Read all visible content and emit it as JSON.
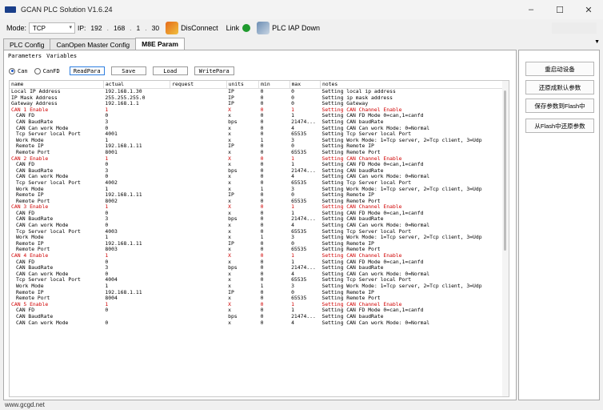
{
  "window": {
    "title": "GCAN PLC Solution V1.6.24",
    "minimize": "–",
    "maximize": "☐",
    "close": "✕"
  },
  "toolbar": {
    "mode_label": "Mode:",
    "mode_value": "TCP",
    "ip_label": "IP:",
    "ip": [
      "192",
      "168",
      "1",
      "30"
    ],
    "disconnect_label": "DisConnect",
    "link_label": "Link",
    "link_status_color": "#1f9a2e",
    "plc_iap_label": "PLC IAP Down"
  },
  "tabs": [
    {
      "label": "PLC Config",
      "active": false
    },
    {
      "label": "CanOpen Master Config",
      "active": false
    },
    {
      "label": "M8E Param",
      "active": true
    }
  ],
  "subtabs": [
    "Parameters",
    "Variables"
  ],
  "controls": {
    "radio_can": "Can",
    "radio_canfd": "CanFD",
    "buttons": [
      "ReadPara",
      "Save",
      "Load",
      "WritePara"
    ]
  },
  "grid": {
    "columns": [
      "name",
      "actual",
      "request",
      "units",
      "min",
      "max",
      "notes"
    ],
    "rows": [
      {
        "name": "Local IP Address",
        "actual": "192.168.1.30",
        "units": "IP",
        "min": "0",
        "max": "0",
        "notes": "Setting local ip address",
        "hl": false,
        "indent": false
      },
      {
        "name": "IP Mask Address",
        "actual": "255.255.255.0",
        "units": "IP",
        "min": "0",
        "max": "0",
        "notes": "Setting ip mask address",
        "hl": false,
        "indent": false
      },
      {
        "name": "Gateway Address",
        "actual": "192.168.1.1",
        "units": "IP",
        "min": "0",
        "max": "0",
        "notes": "Setting Gateway",
        "hl": false,
        "indent": false
      },
      {
        "name": "CAN 1 Enable",
        "actual": "1",
        "units": "X",
        "min": "0",
        "max": "1",
        "notes": "Setting CAN Channel Enable",
        "hl": true,
        "indent": false
      },
      {
        "name": "CAN FD",
        "actual": "0",
        "units": "x",
        "min": "0",
        "max": "1",
        "notes": "Setting CAN FD Mode 0=can,1=canfd",
        "hl": false,
        "indent": true
      },
      {
        "name": "CAN BaudRate",
        "actual": "3",
        "units": "bps",
        "min": "0",
        "max": "21474...",
        "notes": "Setting CAN baudRate",
        "hl": false,
        "indent": true
      },
      {
        "name": "CAN Can work Mode",
        "actual": "0",
        "units": "x",
        "min": "0",
        "max": "4",
        "notes": "Setting CAN Can work Mode: 0=Normal",
        "hl": false,
        "indent": true
      },
      {
        "name": "Tcp Server local Port",
        "actual": "4001",
        "units": "x",
        "min": "0",
        "max": "65535",
        "notes": "Setting Tcp Server local Port",
        "hl": false,
        "indent": true
      },
      {
        "name": "Work Mode",
        "actual": "1",
        "units": "x",
        "min": "1",
        "max": "3",
        "notes": "Setting Work Mode: 1=Tcp server, 2=Tcp client, 3=Udp",
        "hl": false,
        "indent": true
      },
      {
        "name": "Remote IP",
        "actual": "192.168.1.11",
        "units": "IP",
        "min": "0",
        "max": "0",
        "notes": "Setting Remote IP",
        "hl": false,
        "indent": true
      },
      {
        "name": "Remote Port",
        "actual": "8001",
        "units": "x",
        "min": "0",
        "max": "65535",
        "notes": "Setting Remote Port",
        "hl": false,
        "indent": true
      },
      {
        "name": "CAN 2 Enable",
        "actual": "1",
        "units": "X",
        "min": "0",
        "max": "1",
        "notes": "Setting CAN Channel Enable",
        "hl": true,
        "indent": false
      },
      {
        "name": "CAN FD",
        "actual": "0",
        "units": "x",
        "min": "0",
        "max": "1",
        "notes": "Setting CAN FD Mode 0=can,1=canfd",
        "hl": false,
        "indent": true
      },
      {
        "name": "CAN BaudRate",
        "actual": "3",
        "units": "bps",
        "min": "0",
        "max": "21474...",
        "notes": "Setting CAN baudRate",
        "hl": false,
        "indent": true
      },
      {
        "name": "CAN Can work Mode",
        "actual": "0",
        "units": "x",
        "min": "0",
        "max": "4",
        "notes": "Setting CAN Can work Mode: 0=Normal",
        "hl": false,
        "indent": true
      },
      {
        "name": "Tcp Server local Port",
        "actual": "4002",
        "units": "x",
        "min": "0",
        "max": "65535",
        "notes": "Setting Tcp Server local Port",
        "hl": false,
        "indent": true
      },
      {
        "name": "Work Mode",
        "actual": "1",
        "units": "x",
        "min": "1",
        "max": "3",
        "notes": "Setting Work Mode: 1=Tcp server, 2=Tcp client, 3=Udp",
        "hl": false,
        "indent": true
      },
      {
        "name": "Remote IP",
        "actual": "192.168.1.11",
        "units": "IP",
        "min": "0",
        "max": "0",
        "notes": "Setting Remote IP",
        "hl": false,
        "indent": true
      },
      {
        "name": "Remote Port",
        "actual": "8002",
        "units": "x",
        "min": "0",
        "max": "65535",
        "notes": "Setting Remote Port",
        "hl": false,
        "indent": true
      },
      {
        "name": "CAN 3 Enable",
        "actual": "1",
        "units": "X",
        "min": "0",
        "max": "1",
        "notes": "Setting CAN Channel Enable",
        "hl": true,
        "indent": false
      },
      {
        "name": "CAN FD",
        "actual": "0",
        "units": "x",
        "min": "0",
        "max": "1",
        "notes": "Setting CAN FD Mode 0=can,1=canfd",
        "hl": false,
        "indent": true
      },
      {
        "name": "CAN BaudRate",
        "actual": "3",
        "units": "bps",
        "min": "0",
        "max": "21474...",
        "notes": "Setting CAN baudRate",
        "hl": false,
        "indent": true
      },
      {
        "name": "CAN Can work Mode",
        "actual": "0",
        "units": "x",
        "min": "0",
        "max": "4",
        "notes": "Setting CAN Can work Mode: 0=Normal",
        "hl": false,
        "indent": true
      },
      {
        "name": "Tcp Server local Port",
        "actual": "4003",
        "units": "x",
        "min": "0",
        "max": "65535",
        "notes": "Setting Tcp Server local Port",
        "hl": false,
        "indent": true
      },
      {
        "name": "Work Mode",
        "actual": "1",
        "units": "x",
        "min": "1",
        "max": "3",
        "notes": "Setting Work Mode: 1=Tcp server, 2=Tcp client, 3=Udp",
        "hl": false,
        "indent": true
      },
      {
        "name": "Remote IP",
        "actual": "192.168.1.11",
        "units": "IP",
        "min": "0",
        "max": "0",
        "notes": "Setting Remote IP",
        "hl": false,
        "indent": true
      },
      {
        "name": "Remote Port",
        "actual": "8003",
        "units": "x",
        "min": "0",
        "max": "65535",
        "notes": "Setting Remote Port",
        "hl": false,
        "indent": true
      },
      {
        "name": "CAN 4 Enable",
        "actual": "1",
        "units": "X",
        "min": "0",
        "max": "1",
        "notes": "Setting CAN Channel Enable",
        "hl": true,
        "indent": false
      },
      {
        "name": "CAN FD",
        "actual": "0",
        "units": "x",
        "min": "0",
        "max": "1",
        "notes": "Setting CAN FD Mode 0=can,1=canfd",
        "hl": false,
        "indent": true
      },
      {
        "name": "CAN BaudRate",
        "actual": "3",
        "units": "bps",
        "min": "0",
        "max": "21474...",
        "notes": "Setting CAN baudRate",
        "hl": false,
        "indent": true
      },
      {
        "name": "CAN Can work Mode",
        "actual": "0",
        "units": "x",
        "min": "0",
        "max": "4",
        "notes": "Setting CAN Can work Mode: 0=Normal",
        "hl": false,
        "indent": true
      },
      {
        "name": "Tcp Server local Port",
        "actual": "4004",
        "units": "x",
        "min": "0",
        "max": "65535",
        "notes": "Setting Tcp Server local Port",
        "hl": false,
        "indent": true
      },
      {
        "name": "Work Mode",
        "actual": "1",
        "units": "x",
        "min": "1",
        "max": "3",
        "notes": "Setting Work Mode: 1=Tcp server, 2=Tcp client, 3=Udp",
        "hl": false,
        "indent": true
      },
      {
        "name": "Remote IP",
        "actual": "192.168.1.11",
        "units": "IP",
        "min": "0",
        "max": "0",
        "notes": "Setting Remote IP",
        "hl": false,
        "indent": true
      },
      {
        "name": "Remote Port",
        "actual": "8004",
        "units": "x",
        "min": "0",
        "max": "65535",
        "notes": "Setting Remote Port",
        "hl": false,
        "indent": true
      },
      {
        "name": "CAN 5 Enable",
        "actual": "1",
        "units": "X",
        "min": "0",
        "max": "1",
        "notes": "Setting CAN Channel Enable",
        "hl": true,
        "indent": false
      },
      {
        "name": "CAN FD",
        "actual": "0",
        "units": "x",
        "min": "0",
        "max": "1",
        "notes": "Setting CAN FD Mode 0=can,1=canfd",
        "hl": false,
        "indent": true
      },
      {
        "name": "CAN BaudRate",
        "actual": "",
        "units": "bps",
        "min": "0",
        "max": "21474...",
        "notes": "Setting CAN baudRate",
        "hl": false,
        "indent": true
      },
      {
        "name": "CAN Can work Mode",
        "actual": "0",
        "units": "x",
        "min": "0",
        "max": "4",
        "notes": "Setting CAN Can work Mode: 0=Normal",
        "hl": false,
        "indent": true
      }
    ]
  },
  "side_buttons": [
    "重启动设备",
    "还原成默认参数",
    "保存参数到Flash中",
    "从Flash中还原参数"
  ],
  "status": {
    "text": "www.gcgd.net"
  }
}
